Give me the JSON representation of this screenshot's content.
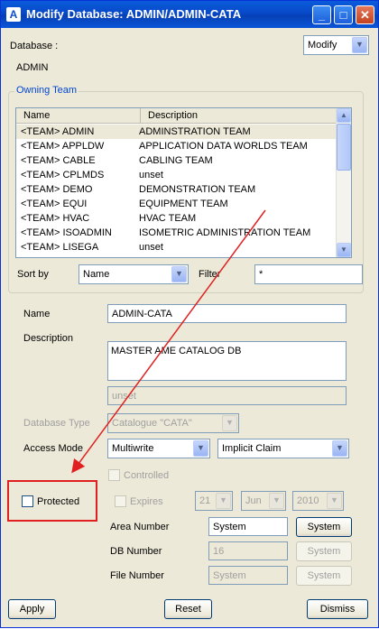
{
  "window": {
    "title": "Modify Database: ADMIN/ADMIN-CATA",
    "icon": "A",
    "controls": {
      "minimize": "_",
      "maximize": "□",
      "close": "✕"
    }
  },
  "database": {
    "label": "Database :",
    "value": "ADMIN",
    "mode": "Modify"
  },
  "owning_team": {
    "title": "Owning Team",
    "columns": [
      "Name",
      "Description"
    ],
    "rows": [
      {
        "name": "<TEAM>  ADMIN",
        "description": "ADMINSTRATION TEAM"
      },
      {
        "name": "<TEAM>  APPLDW",
        "description": "APPLICATION DATA WORLDS TEAM"
      },
      {
        "name": "<TEAM>  CABLE",
        "description": "CABLING TEAM"
      },
      {
        "name": "<TEAM>  CPLMDS",
        "description": "unset"
      },
      {
        "name": "<TEAM>  DEMO",
        "description": "DEMONSTRATION TEAM"
      },
      {
        "name": "<TEAM>  EQUI",
        "description": "EQUIPMENT TEAM"
      },
      {
        "name": "<TEAM>  HVAC",
        "description": "HVAC TEAM"
      },
      {
        "name": "<TEAM>  ISOADMIN",
        "description": "ISOMETRIC ADMINISTRATION TEAM"
      },
      {
        "name": "<TEAM>  LISEGA",
        "description": "unset"
      }
    ],
    "sort_by_label": "Sort by",
    "sort_by_value": "Name",
    "filter_label": "Filter",
    "filter_value": "*"
  },
  "form": {
    "name_label": "Name",
    "name_value": "ADMIN-CATA",
    "description_label": "Description",
    "description_value": "MASTER AME CATALOG DB",
    "unset_value": "unset",
    "db_type_label": "Database Type",
    "db_type_value": "Catalogue \"CATA\"",
    "access_mode_label": "Access Mode",
    "access_mode_value": "Multiwrite",
    "claim_value": "Implicit Claim",
    "controlled_label": "Controlled",
    "protected_label": "Protected",
    "expires_label": "Expires",
    "expires_day": "21",
    "expires_month": "Jun",
    "expires_year": "2010",
    "area_number_label": "Area Number",
    "area_number_value": "System",
    "db_number_label": "DB Number",
    "db_number_value": "16",
    "file_number_label": "File Number",
    "file_number_value": "System",
    "system_button_label": "System"
  },
  "buttons": {
    "apply": "Apply",
    "reset": "Reset",
    "dismiss": "Dismiss"
  },
  "annotation": {
    "color": "#e02020"
  }
}
